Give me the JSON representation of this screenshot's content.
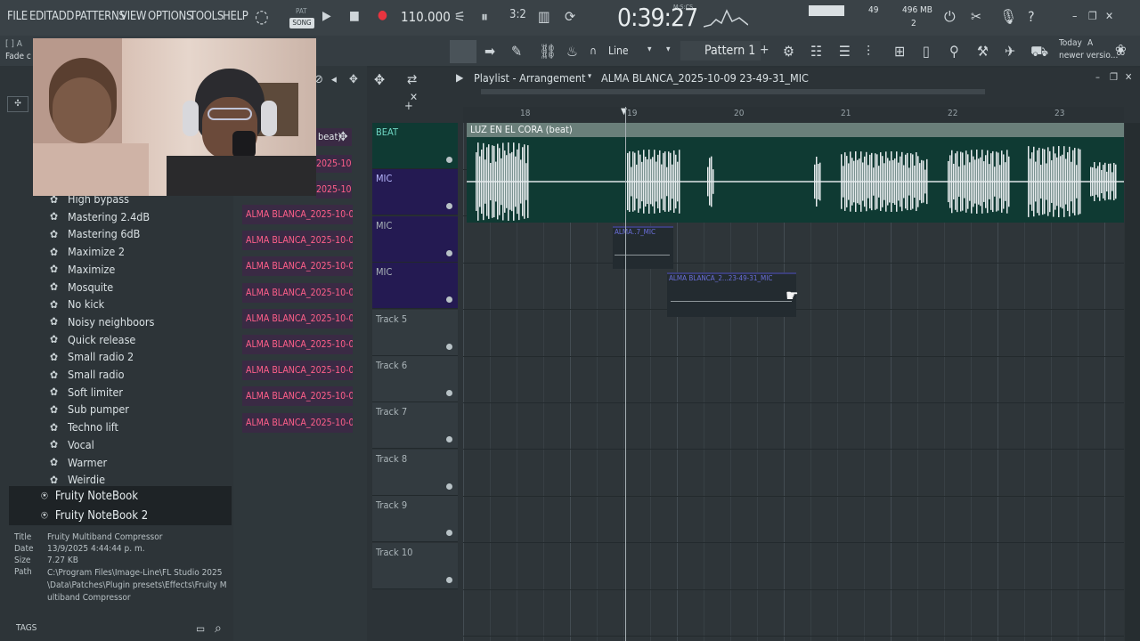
{
  "menu": [
    "FILE",
    "EDIT",
    "ADD",
    "PATTERNS",
    "VIEW",
    "OPTIONS",
    "TOOLS",
    "HELP"
  ],
  "transport": {
    "pat_label": "PAT",
    "song_label": "SONG",
    "tempo": "110.000",
    "time": "0:39:27",
    "time_format": "M:S:CS"
  },
  "meters": {
    "cpu_value": "49",
    "memory": "496 MB",
    "voices": "2"
  },
  "hint": {
    "line1": "Today",
    "line2": "newer versio...",
    "letter": "A"
  },
  "toolbar": {
    "snap": "Line",
    "pattern": "Pattern 1"
  },
  "left_hint": {
    "bracket": "[ ] A",
    "fade": "Fade c"
  },
  "playlist": {
    "title": "Playlist - Arrangement",
    "project": "ALMA BLANCA_2025-10-09 23-49-31_MIC"
  },
  "ruler": [
    "18",
    "19",
    "20",
    "21",
    "22",
    "23"
  ],
  "browser_items": [
    "High bypass",
    "Mastering 2.4dB",
    "Mastering 6dB",
    "Maximize 2",
    "Maximize",
    "Mosquite",
    "No kick",
    "Noisy neighboors",
    "Quick release",
    "Small radio 2",
    "Small radio",
    "Soft limiter",
    "Sub pumper",
    "Techno lift",
    "Vocal",
    "Warmer",
    "Weirdie"
  ],
  "notebooks": [
    "Fruity NoteBook",
    "Fruity NoteBook 2"
  ],
  "file_info": {
    "title_label": "Title",
    "title": "Fruity Multiband Compressor",
    "date_label": "Date",
    "date": "13/9/2025 4:44:44 p. m.",
    "size_label": "Size",
    "size": "7.27 KB",
    "path_label": "Path",
    "path": "C:\\Program Files\\Image-Line\\FL Studio 2025\\Data\\Patches\\Plugin presets\\Effects\\Fruity Multiband Compressor"
  },
  "tags_label": "TAGS",
  "channels_top": [
    "beat)",
    "2025-10-0...",
    "2025-10-0..."
  ],
  "channels": [
    "ALMA BLANCA_2025-10-0...",
    "ALMA BLANCA_2025-10-0...",
    "ALMA BLANCA_2025-10-0...",
    "ALMA BLANCA_2025-10-0...",
    "ALMA BLANCA_2025-10-0...",
    "ALMA BLANCA_2025-10-0...",
    "ALMA BLANCA_2025-10-0...",
    "ALMA BLANCA_2025-10-0...",
    "ALMA BLANCA_2025-10-0..."
  ],
  "tracks": [
    "BEAT",
    "MIC",
    "MIC",
    "MIC",
    "Track 5",
    "Track 6",
    "Track 7",
    "Track 8",
    "Track 9",
    "Track 10"
  ],
  "clips": {
    "beat": "LUZ EN EL CORA (beat)",
    "mic1": "ALMA..7_MIC",
    "mic2": "ALMA BLANCA_2...23-49-31_MIC"
  },
  "colors": {
    "accent": "#ff5f8a",
    "beat_clip": "#0f3a33",
    "mic_track": "#241a52",
    "transport_red": "#e8343f"
  }
}
